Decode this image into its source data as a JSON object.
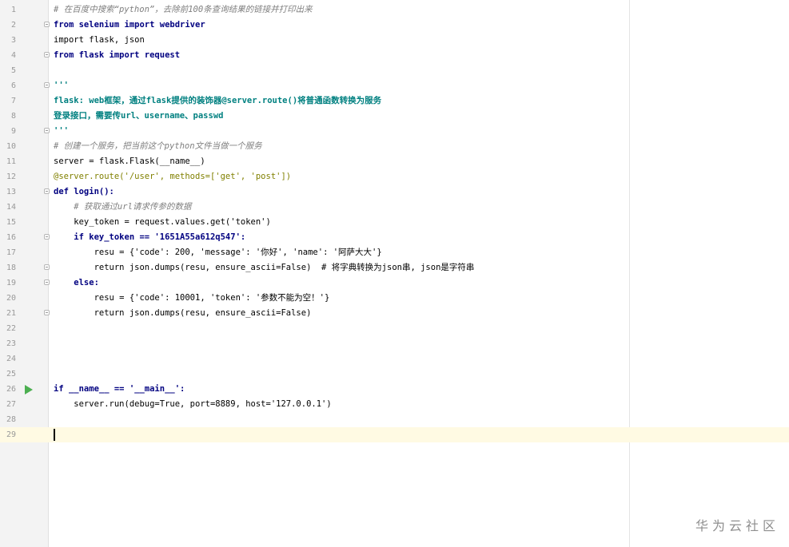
{
  "editor": {
    "lines": [
      {
        "n": "1",
        "t": "# 在百度中搜索“python”，去除前100条查询结果的链接并打印出来"
      },
      {
        "n": "2",
        "t": "from selenium import webdriver"
      },
      {
        "n": "3",
        "t": "import flask, json"
      },
      {
        "n": "4",
        "t": "from flask import request"
      },
      {
        "n": "5",
        "t": ""
      },
      {
        "n": "6",
        "t": "'''"
      },
      {
        "n": "7",
        "t": "flask: web框架，通过flask提供的装饰器@server.route()将普通函数转换为服务"
      },
      {
        "n": "8",
        "t": "登录接口，需要传url、username、passwd"
      },
      {
        "n": "9",
        "t": "'''"
      },
      {
        "n": "10",
        "t": "# 创建一个服务，把当前这个python文件当做一个服务"
      },
      {
        "n": "11",
        "t": "server = flask.Flask(__name__)"
      },
      {
        "n": "12",
        "t": "@server.route('/user', methods=['get', 'post'])"
      },
      {
        "n": "13",
        "t": "def login():"
      },
      {
        "n": "14",
        "t": "    # 获取通过url请求传参的数据"
      },
      {
        "n": "15",
        "t": "    key_token = request.values.get('token')"
      },
      {
        "n": "16",
        "t": "    if key_token == '1651A55a612q547':"
      },
      {
        "n": "17",
        "t": "        resu = {'code': 200, 'message': '你好', 'name': '阿萨大大'}"
      },
      {
        "n": "18",
        "t": "        return json.dumps(resu, ensure_ascii=False)  # 将字典转换为json串, json是字符串"
      },
      {
        "n": "19",
        "t": "    else:"
      },
      {
        "n": "20",
        "t": "        resu = {'code': 10001, 'token': '参数不能为空！'}"
      },
      {
        "n": "21",
        "t": "        return json.dumps(resu, ensure_ascii=False)"
      },
      {
        "n": "22",
        "t": ""
      },
      {
        "n": "23",
        "t": ""
      },
      {
        "n": "24",
        "t": ""
      },
      {
        "n": "25",
        "t": ""
      },
      {
        "n": "26",
        "t": "if __name__ == '__main__':"
      },
      {
        "n": "27",
        "t": "    server.run(debug=True, port=8889, host='127.0.0.1')"
      },
      {
        "n": "28",
        "t": ""
      },
      {
        "n": "29",
        "t": ""
      }
    ]
  },
  "watermark": "华为云社区",
  "colors": {
    "keyword": "#000080",
    "string": "#008080",
    "comment": "#808080",
    "number": "#0000ff",
    "decorator": "#808000",
    "param": "#660099",
    "current_line": "#fffae3",
    "run_icon": "#4caf50"
  }
}
